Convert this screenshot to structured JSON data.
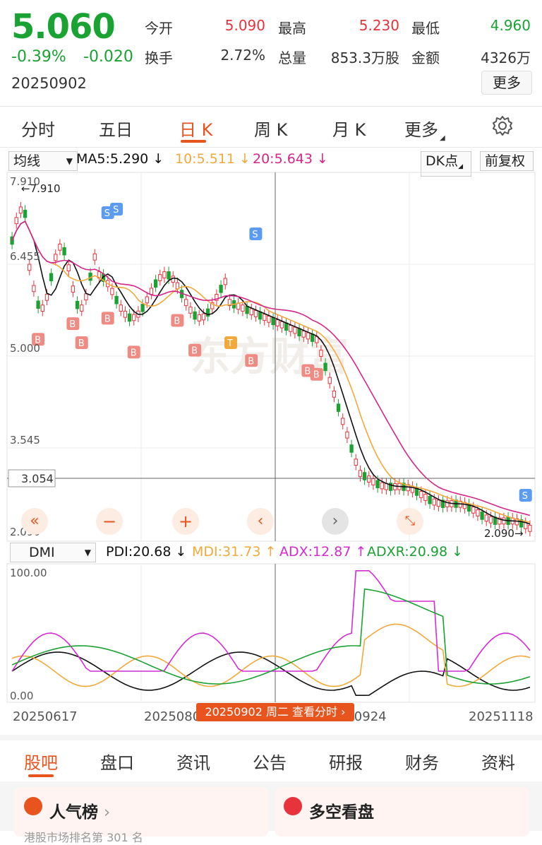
{
  "quote": {
    "price": "5.060",
    "change_pct": "-0.39%",
    "change_abs": "-0.020",
    "date": "20250902",
    "open_label": "今开",
    "open_value": "5.090",
    "high_label": "最高",
    "high_value": "5.230",
    "low_label": "最低",
    "low_value": "4.960",
    "turnover_label": "换手",
    "turnover_value": "2.72%",
    "volume_label": "总量",
    "volume_value": "853.3万股",
    "amount_label": "金额",
    "amount_value": "4326万",
    "more_button": "更多"
  },
  "period_tabs": [
    {
      "label": "分时"
    },
    {
      "label": "五日"
    },
    {
      "label": "日 K"
    },
    {
      "label": "周 K"
    },
    {
      "label": "月 K"
    },
    {
      "label": "更多"
    }
  ],
  "active_period": "日 K",
  "ma_bar": {
    "selector": "均线",
    "ma5": "MA5:5.290 ↓",
    "ma10": "10:5.511 ↓",
    "ma20": "20:5.643 ↓",
    "dk_button": "DK点",
    "adjust_button": "前复权"
  },
  "kline": {
    "y_labels": [
      "7.910",
      "6.455",
      "5.000",
      "3.545",
      "2.090"
    ],
    "max_marker": "←7.910",
    "min_marker": "2.090→",
    "crosshair_price": "3.054",
    "watermark": "东方财富",
    "signals": {
      "buy": "B",
      "sell": "S",
      "t": "T"
    }
  },
  "dmi_bar": {
    "selector": "DMI",
    "pdi": "PDI:20.68 ↓",
    "mdi": "MDI:31.73 ↑",
    "adx": "ADX:12.87 ↑",
    "adxr": "ADXR:20.98 ↓"
  },
  "dmi": {
    "y_top": "100.00",
    "y_bottom": "0.00"
  },
  "x_dates": [
    "20250617",
    "20250806",
    "20250924",
    "20251118"
  ],
  "time_tip": "20250902 周二 查看分时",
  "bottom_tabs": [
    {
      "label": "股吧"
    },
    {
      "label": "盘口"
    },
    {
      "label": "资讯"
    },
    {
      "label": "公告"
    },
    {
      "label": "研报"
    },
    {
      "label": "财务"
    },
    {
      "label": "资料"
    }
  ],
  "active_bottom_tab": "股吧",
  "cards": {
    "popular_title": "人气榜",
    "sentiment_title": "多空看盘",
    "popular_sub": "港股市场排名第 301 名"
  },
  "colors": {
    "up": "#e8323c",
    "down": "#1aa232",
    "accent": "#e8541e",
    "ma5": "#111111",
    "ma10": "#f2a93b",
    "ma20": "#d6268a",
    "pdi": "#111111",
    "mdi": "#f2a93b",
    "adx": "#d62ad6",
    "adxr": "#1aa232"
  }
}
